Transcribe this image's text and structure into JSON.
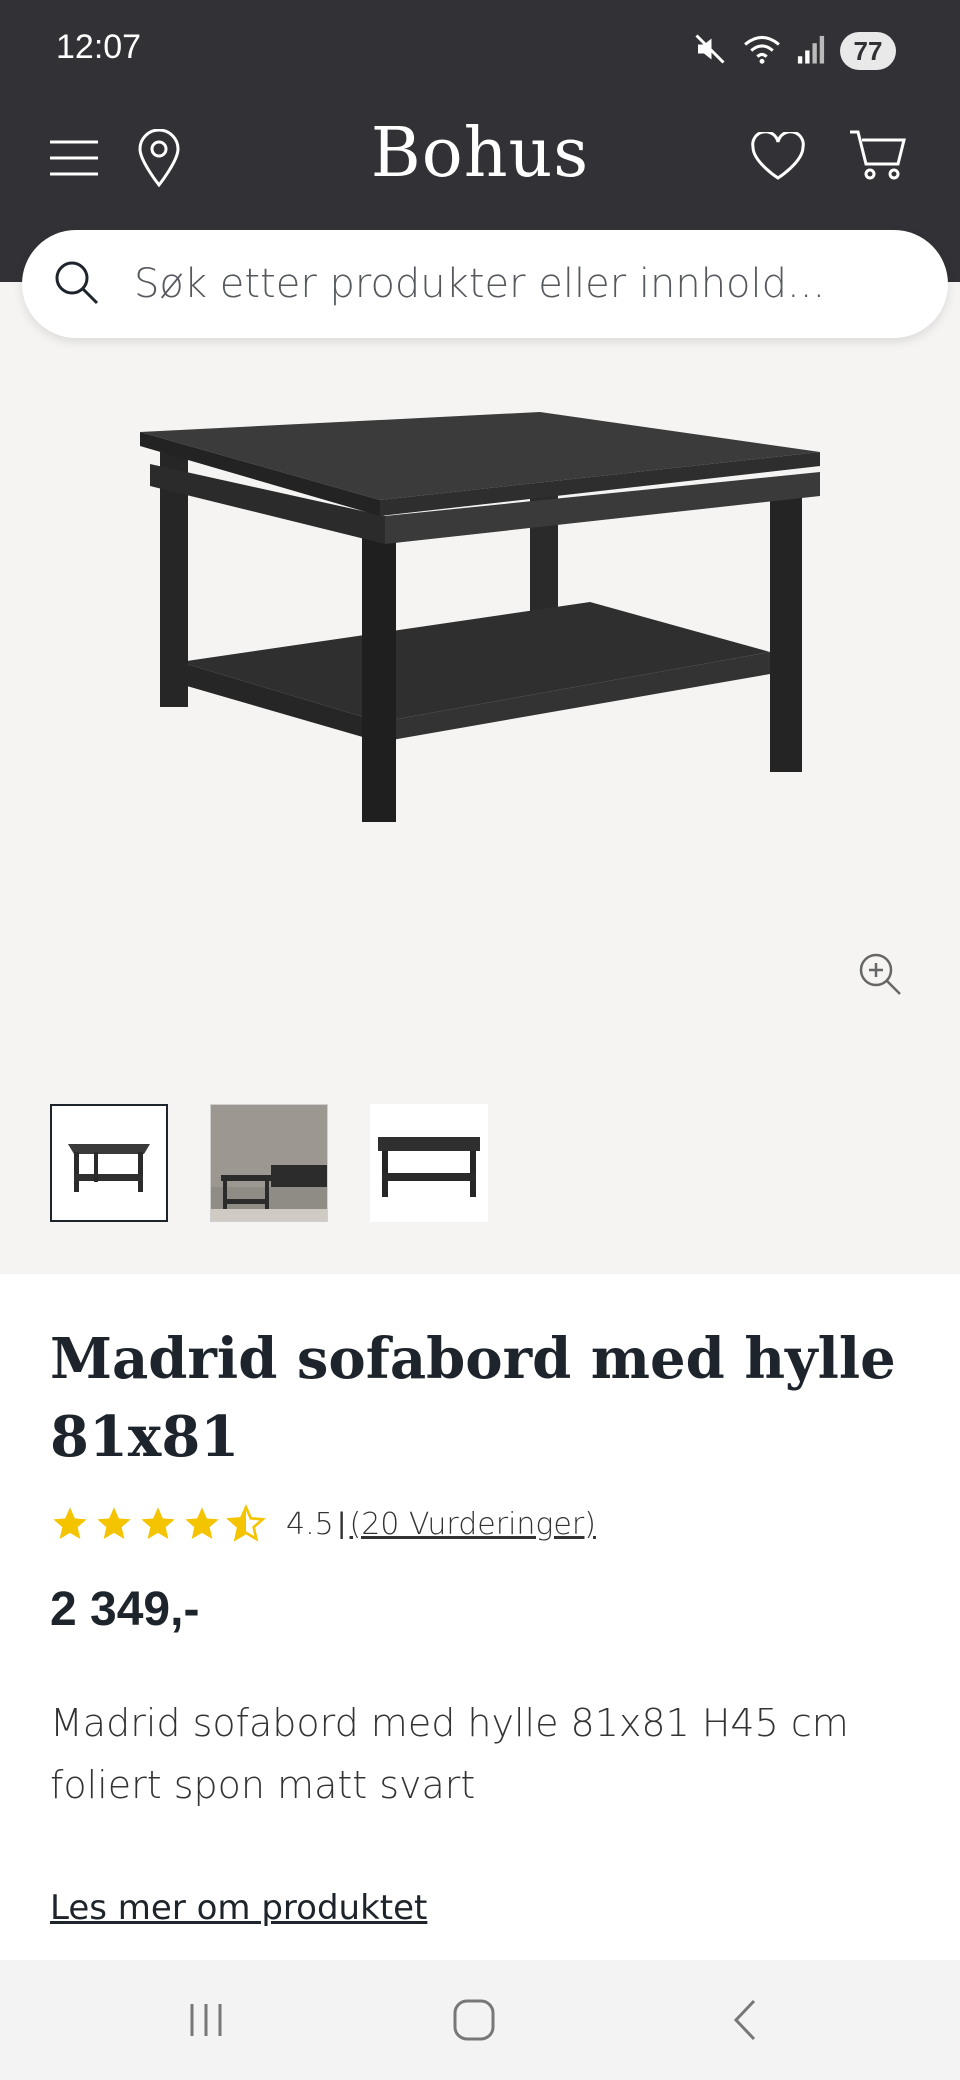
{
  "status_bar": {
    "time": "12:07",
    "battery": "77",
    "icons": [
      "mute-icon",
      "wifi-icon",
      "signal-icon",
      "battery-icon"
    ]
  },
  "header": {
    "logo": "Bohus",
    "icons": [
      "menu-icon",
      "location-pin-icon",
      "heart-icon",
      "cart-icon"
    ],
    "background_color": "#323136"
  },
  "search": {
    "placeholder": "Søk etter produkter eller innhold..."
  },
  "gallery": {
    "thumbnails": [
      "thumbnail-table-front",
      "thumbnail-room-scene",
      "thumbnail-table-side"
    ],
    "active_index": 0
  },
  "product": {
    "title": "Madrid sofabord med hylle 81x81",
    "rating_value": "4.5",
    "rating_separator": "|",
    "rating_link": "(20 Vurderinger)",
    "rating_stars": 4.5,
    "price": "2 349,-",
    "description": "Madrid sofabord med hylle 81x81 H45 cm foliert spon matt svart",
    "read_more": "Les mer om produktet"
  },
  "system_nav": {
    "buttons": [
      "recent-apps-icon",
      "home-icon",
      "back-icon"
    ]
  },
  "colors": {
    "star": "#f5c400",
    "text": "#1e242b",
    "gallery_bg": "#f5f4f2"
  }
}
